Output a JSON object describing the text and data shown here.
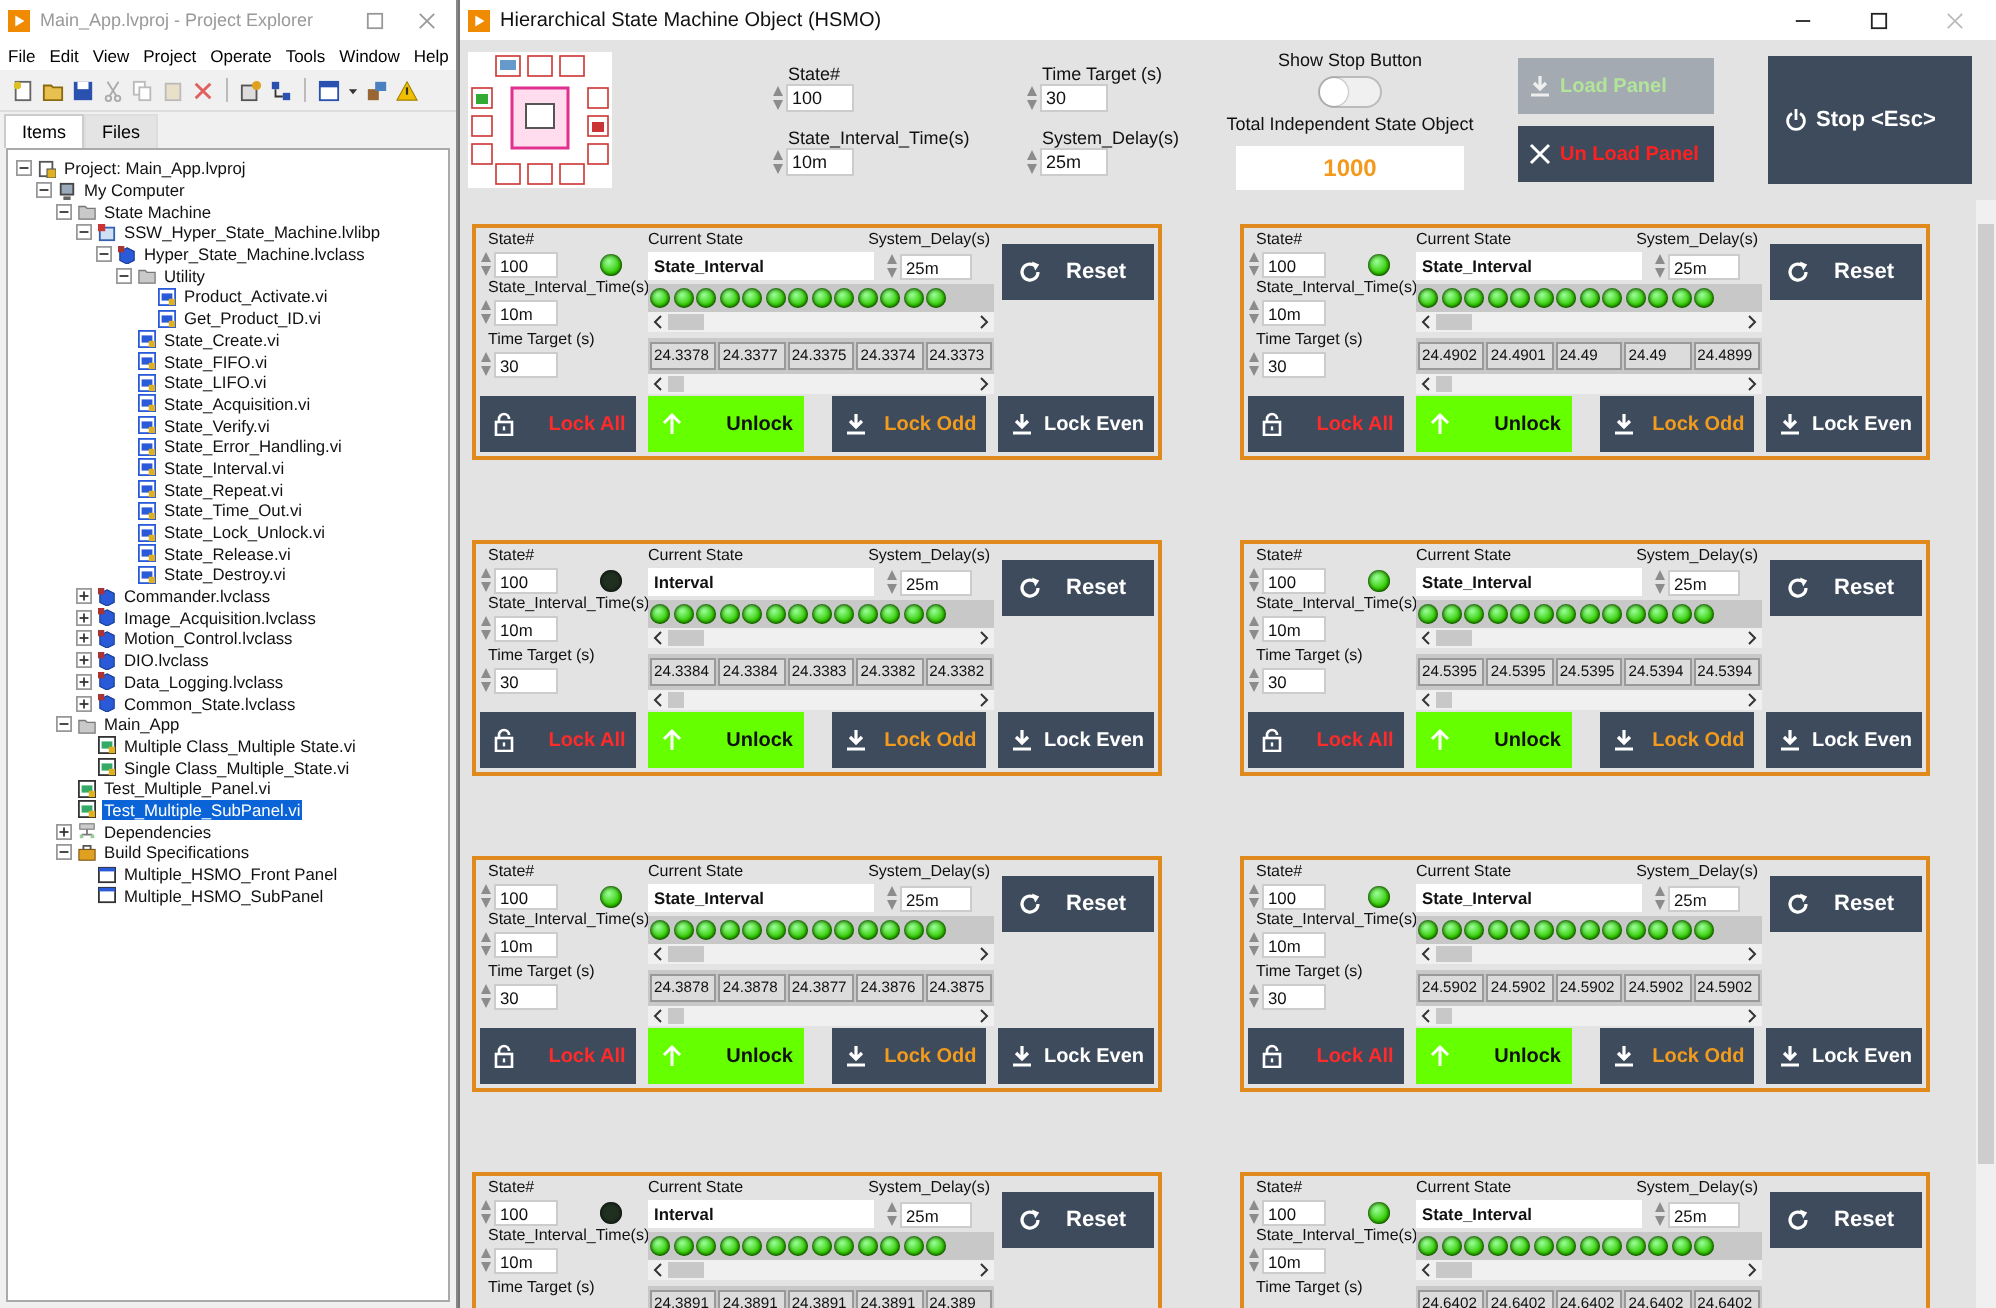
{
  "project_window": {
    "title": "Main_App.lvproj - Project Explorer",
    "menu": [
      "File",
      "Edit",
      "View",
      "Project",
      "Operate",
      "Tools",
      "Window",
      "Help"
    ],
    "tabs": [
      {
        "label": "Items",
        "selected": true
      },
      {
        "label": "Files",
        "selected": false
      }
    ],
    "tree": [
      {
        "label": "Project: Main_App.lvproj",
        "kind": "project",
        "expanded": true,
        "selected": false,
        "children": [
          {
            "label": "My Computer",
            "kind": "computer",
            "expanded": true,
            "selected": false,
            "children": [
              {
                "label": "State Machine",
                "kind": "folder",
                "expanded": true,
                "selected": false,
                "children": [
                  {
                    "label": "SSW_Hyper_State_Machine.lvlibp",
                    "kind": "library",
                    "expanded": true,
                    "selected": false,
                    "children": [
                      {
                        "label": "Hyper_State_Machine.lvclass",
                        "kind": "class",
                        "expanded": true,
                        "selected": false,
                        "children": [
                          {
                            "label": "Utility",
                            "kind": "folder",
                            "expanded": true,
                            "selected": false,
                            "children": [
                              {
                                "label": "Product_Activate.vi",
                                "kind": "vi",
                                "selected": false
                              },
                              {
                                "label": "Get_Product_ID.vi",
                                "kind": "vi",
                                "selected": false
                              }
                            ]
                          },
                          {
                            "label": "State_Create.vi",
                            "kind": "vi",
                            "selected": false
                          },
                          {
                            "label": "State_FIFO.vi",
                            "kind": "vi",
                            "selected": false
                          },
                          {
                            "label": "State_LIFO.vi",
                            "kind": "vi",
                            "selected": false
                          },
                          {
                            "label": "State_Acquisition.vi",
                            "kind": "vi",
                            "selected": false
                          },
                          {
                            "label": "State_Verify.vi",
                            "kind": "vi",
                            "selected": false
                          },
                          {
                            "label": "State_Error_Handling.vi",
                            "kind": "vi",
                            "selected": false
                          },
                          {
                            "label": "State_Interval.vi",
                            "kind": "vi",
                            "selected": false
                          },
                          {
                            "label": "State_Repeat.vi",
                            "kind": "vi",
                            "selected": false
                          },
                          {
                            "label": "State_Time_Out.vi",
                            "kind": "vi",
                            "selected": false
                          },
                          {
                            "label": "State_Lock_Unlock.vi",
                            "kind": "vi",
                            "selected": false
                          },
                          {
                            "label": "State_Release.vi",
                            "kind": "vi",
                            "selected": false
                          },
                          {
                            "label": "State_Destroy.vi",
                            "kind": "vi",
                            "selected": false
                          }
                        ]
                      }
                    ]
                  },
                  {
                    "label": "Commander.lvclass",
                    "kind": "class",
                    "expanded": false,
                    "selected": false
                  },
                  {
                    "label": "Image_Acquisition.lvclass",
                    "kind": "class",
                    "expanded": false,
                    "selected": false
                  },
                  {
                    "label": "Motion_Control.lvclass",
                    "kind": "class",
                    "expanded": false,
                    "selected": false
                  },
                  {
                    "label": "DIO.lvclass",
                    "kind": "class",
                    "expanded": false,
                    "selected": false
                  },
                  {
                    "label": "Data_Logging.lvclass",
                    "kind": "class",
                    "expanded": false,
                    "selected": false
                  },
                  {
                    "label": "Common_State.lvclass",
                    "kind": "class",
                    "expanded": false,
                    "selected": false
                  }
                ]
              },
              {
                "label": "Main_App",
                "kind": "folder",
                "expanded": true,
                "selected": false,
                "children": [
                  {
                    "label": "Multiple Class_Multiple State.vi",
                    "kind": "app-vi",
                    "selected": false
                  },
                  {
                    "label": "Single Class_Multiple_State.vi",
                    "kind": "app-vi",
                    "selected": false
                  }
                ]
              },
              {
                "label": "Test_Multiple_Panel.vi",
                "kind": "app-vi",
                "selected": false
              },
              {
                "label": "Test_Multiple_SubPanel.vi",
                "kind": "app-vi",
                "selected": true
              },
              {
                "label": "Dependencies",
                "kind": "dependencies",
                "expanded": false,
                "selected": false
              },
              {
                "label": "Build Specifications",
                "kind": "build",
                "expanded": true,
                "selected": false,
                "children": [
                  {
                    "label": "Multiple_HSMO_Front Panel",
                    "kind": "build-item",
                    "selected": false
                  },
                  {
                    "label": "Multiple_HSMO_SubPanel",
                    "kind": "build-item",
                    "selected": false
                  }
                ]
              }
            ]
          }
        ]
      }
    ]
  },
  "hsmo_window": {
    "title": "Hierarchical State Machine Object (HSMO)",
    "controls": [
      {
        "label": "State#",
        "value": "100"
      },
      {
        "label": "Time Target (s)",
        "value": "30"
      },
      {
        "label": "State_Interval_Time(s)",
        "value": "10m"
      },
      {
        "label": "System_Delay(s)",
        "value": "25m"
      }
    ],
    "show_stop": {
      "label": "Show Stop Button",
      "on": false
    },
    "total": {
      "label": "Total Independent State Object",
      "value": "1000"
    },
    "buttons": [
      {
        "kind": "load",
        "label": "Load Panel",
        "disabled": true
      },
      {
        "kind": "unload",
        "label": "Un Load Panel",
        "disabled": false
      }
    ],
    "stop_button": {
      "label": "Stop <Esc>"
    },
    "modules": [
      {
        "state_label": "State#",
        "state": "100",
        "led_on": true,
        "interval_label": "State_Interval_Time(s)",
        "interval": "10m",
        "target_label": "Time Target (s)",
        "target": "30",
        "current_label": "Current State",
        "current": "State_Interval",
        "delay_label": "System_Delay(s)",
        "delay": "25m",
        "reset": "Reset",
        "led_array": [
          true,
          true,
          true,
          true,
          true,
          true,
          true,
          true,
          true,
          true,
          true,
          true,
          true
        ],
        "values": [
          "24.3378",
          "24.3377",
          "24.3375",
          "24.3374",
          "24.3373"
        ],
        "buttons": [
          {
            "kind": "lock_all",
            "label": "Lock All"
          },
          {
            "kind": "unlock",
            "label": "Unlock"
          },
          {
            "kind": "lock_odd",
            "label": "Lock Odd"
          },
          {
            "kind": "lock_even",
            "label": "Lock Even"
          }
        ]
      },
      {
        "state_label": "State#",
        "state": "100",
        "led_on": true,
        "interval_label": "State_Interval_Time(s)",
        "interval": "10m",
        "target_label": "Time Target (s)",
        "target": "30",
        "current_label": "Current State",
        "current": "State_Interval",
        "delay_label": "System_Delay(s)",
        "delay": "25m",
        "reset": "Reset",
        "led_array": [
          true,
          true,
          true,
          true,
          true,
          true,
          true,
          true,
          true,
          true,
          true,
          true,
          true
        ],
        "values": [
          "24.4902",
          "24.4901",
          "24.49",
          "24.49",
          "24.4899"
        ],
        "buttons": [
          {
            "kind": "lock_all",
            "label": "Lock All"
          },
          {
            "kind": "unlock",
            "label": "Unlock"
          },
          {
            "kind": "lock_odd",
            "label": "Lock Odd"
          },
          {
            "kind": "lock_even",
            "label": "Lock Even"
          }
        ]
      },
      {
        "state_label": "State#",
        "state": "100",
        "led_on": false,
        "interval_label": "State_Interval_Time(s)",
        "interval": "10m",
        "target_label": "Time Target (s)",
        "target": "30",
        "current_label": "Current State",
        "current": "Interval",
        "delay_label": "System_Delay(s)",
        "delay": "25m",
        "reset": "Reset",
        "led_array": [
          true,
          true,
          true,
          true,
          true,
          true,
          true,
          true,
          true,
          true,
          true,
          true,
          true
        ],
        "values": [
          "24.3384",
          "24.3384",
          "24.3383",
          "24.3382",
          "24.3382"
        ],
        "buttons": [
          {
            "kind": "lock_all",
            "label": "Lock All"
          },
          {
            "kind": "unlock",
            "label": "Unlock"
          },
          {
            "kind": "lock_odd",
            "label": "Lock Odd"
          },
          {
            "kind": "lock_even",
            "label": "Lock Even"
          }
        ]
      },
      {
        "state_label": "State#",
        "state": "100",
        "led_on": true,
        "interval_label": "State_Interval_Time(s)",
        "interval": "10m",
        "target_label": "Time Target (s)",
        "target": "30",
        "current_label": "Current State",
        "current": "State_Interval",
        "delay_label": "System_Delay(s)",
        "delay": "25m",
        "reset": "Reset",
        "led_array": [
          true,
          true,
          true,
          true,
          true,
          true,
          true,
          true,
          true,
          true,
          true,
          true,
          true
        ],
        "values": [
          "24.5395",
          "24.5395",
          "24.5395",
          "24.5394",
          "24.5394"
        ],
        "buttons": [
          {
            "kind": "lock_all",
            "label": "Lock All"
          },
          {
            "kind": "unlock",
            "label": "Unlock"
          },
          {
            "kind": "lock_odd",
            "label": "Lock Odd"
          },
          {
            "kind": "lock_even",
            "label": "Lock Even"
          }
        ]
      },
      {
        "state_label": "State#",
        "state": "100",
        "led_on": true,
        "interval_label": "State_Interval_Time(s)",
        "interval": "10m",
        "target_label": "Time Target (s)",
        "target": "30",
        "current_label": "Current State",
        "current": "State_Interval",
        "delay_label": "System_Delay(s)",
        "delay": "25m",
        "reset": "Reset",
        "led_array": [
          true,
          true,
          true,
          true,
          true,
          true,
          true,
          true,
          true,
          true,
          true,
          true,
          true
        ],
        "values": [
          "24.3878",
          "24.3878",
          "24.3877",
          "24.3876",
          "24.3875"
        ],
        "buttons": [
          {
            "kind": "lock_all",
            "label": "Lock All"
          },
          {
            "kind": "unlock",
            "label": "Unlock"
          },
          {
            "kind": "lock_odd",
            "label": "Lock Odd"
          },
          {
            "kind": "lock_even",
            "label": "Lock Even"
          }
        ]
      },
      {
        "state_label": "State#",
        "state": "100",
        "led_on": true,
        "interval_label": "State_Interval_Time(s)",
        "interval": "10m",
        "target_label": "Time Target (s)",
        "target": "30",
        "current_label": "Current State",
        "current": "State_Interval",
        "delay_label": "System_Delay(s)",
        "delay": "25m",
        "reset": "Reset",
        "led_array": [
          true,
          true,
          true,
          true,
          true,
          true,
          true,
          true,
          true,
          true,
          true,
          true,
          true
        ],
        "values": [
          "24.5902",
          "24.5902",
          "24.5902",
          "24.5902",
          "24.5902"
        ],
        "buttons": [
          {
            "kind": "lock_all",
            "label": "Lock All"
          },
          {
            "kind": "unlock",
            "label": "Unlock"
          },
          {
            "kind": "lock_odd",
            "label": "Lock Odd"
          },
          {
            "kind": "lock_even",
            "label": "Lock Even"
          }
        ]
      },
      {
        "state_label": "State#",
        "state": "100",
        "led_on": false,
        "interval_label": "State_Interval_Time(s)",
        "interval": "10m",
        "target_label": "Time Target (s)",
        "current_label": "Current State",
        "current": "Interval",
        "delay_label": "System_Delay(s)",
        "delay": "25m",
        "reset": "Reset",
        "led_array": [
          true,
          true,
          true,
          true,
          true,
          true,
          true,
          true,
          true,
          true,
          true,
          true,
          true
        ],
        "values": [
          "24.3891",
          "24.3891",
          "24.3891",
          "24.3891",
          "24.389"
        ]
      },
      {
        "state_label": "State#",
        "state": "100",
        "led_on": true,
        "interval_label": "State_Interval_Time(s)",
        "interval": "10m",
        "target_label": "Time Target (s)",
        "current_label": "Current State",
        "current": "State_Interval",
        "delay_label": "System_Delay(s)",
        "delay": "25m",
        "reset": "Reset",
        "led_array": [
          true,
          true,
          true,
          true,
          true,
          true,
          true,
          true,
          true,
          true,
          true,
          true,
          true
        ],
        "values": [
          "24.6402",
          "24.6402",
          "24.6402",
          "24.6402",
          "24.6402"
        ]
      }
    ]
  }
}
